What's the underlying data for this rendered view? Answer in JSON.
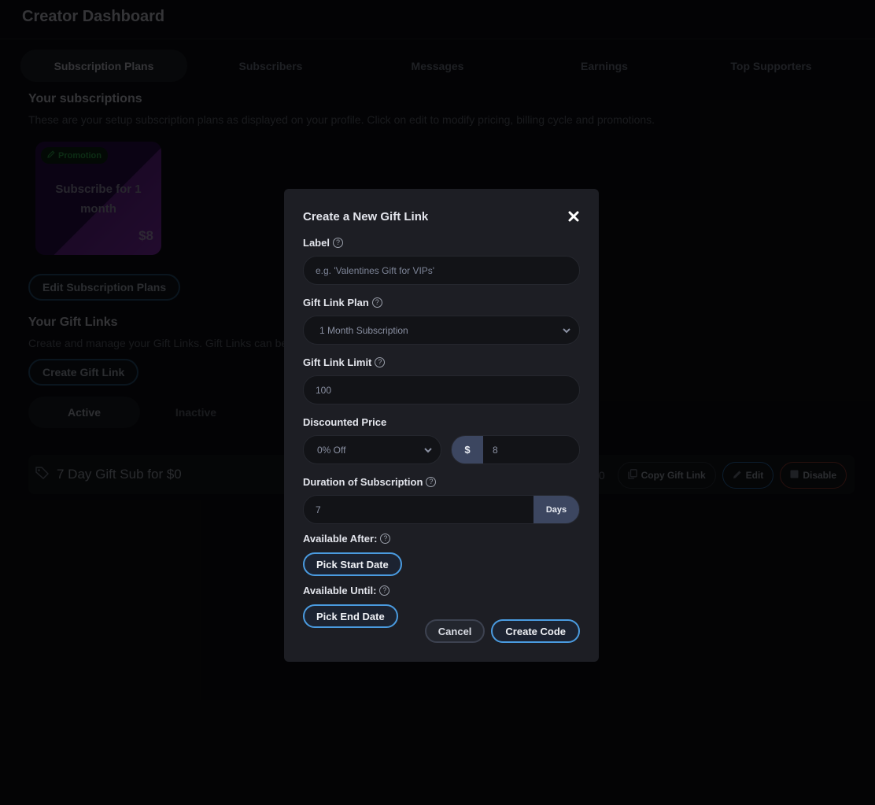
{
  "page": {
    "title": "Creator Dashboard",
    "tabs": [
      {
        "label": "Subscription Plans",
        "active": true
      },
      {
        "label": "Subscribers",
        "active": false
      },
      {
        "label": "Messages",
        "active": false
      },
      {
        "label": "Earnings",
        "active": false
      },
      {
        "label": "Top Supporters",
        "active": false
      }
    ],
    "subscriptions": {
      "title": "Your subscriptions",
      "description": "These are your setup subscription plans as displayed on your profile. Click on edit to modify pricing, billing cycle and promotions.",
      "plan": {
        "badge": "Promotion",
        "name": "Subscribe for 1 month",
        "price": "$8"
      },
      "edit_button": "Edit Subscription Plans"
    },
    "gift_links": {
      "title": "Your Gift Links",
      "description": "Create and manage your Gift Links. Gift Links can be shared with your fans/friends.",
      "create_button": "Create Gift Link",
      "subtabs": [
        {
          "label": "Active",
          "active": true
        },
        {
          "label": "Inactive",
          "active": false
        }
      ],
      "rows": [
        {
          "name": "7 Day Gift Sub for $0",
          "trailing": "0",
          "copy_label": "Copy Gift Link",
          "edit_label": "Edit",
          "disable_label": "Disable"
        }
      ]
    }
  },
  "modal": {
    "title": "Create a New Gift Link",
    "label_field": {
      "label": "Label",
      "placeholder": "e.g. 'Valentines Gift for VIPs'",
      "value": ""
    },
    "plan_field": {
      "label": "Gift Link Plan",
      "selected": "1 Month Subscription"
    },
    "limit_field": {
      "label": "Gift Link Limit",
      "value": "100"
    },
    "discount_field": {
      "label": "Discounted Price",
      "percent_selected": "0% Off",
      "currency_symbol": "$",
      "price_value": "8"
    },
    "duration_field": {
      "label": "Duration of Subscription",
      "value": "7",
      "unit": "Days"
    },
    "available_after": {
      "label": "Available After:",
      "button": "Pick Start Date"
    },
    "available_until": {
      "label": "Available Until:",
      "button": "Pick End Date"
    },
    "cancel_label": "Cancel",
    "create_label": "Create Code",
    "help_glyph": "?"
  },
  "colors": {
    "accent": "#4a9be0",
    "modal_bg": "#1d1e24",
    "addon_bg": "#3c4660",
    "promotion": "#2e9f49",
    "danger": "#8e3a30"
  }
}
